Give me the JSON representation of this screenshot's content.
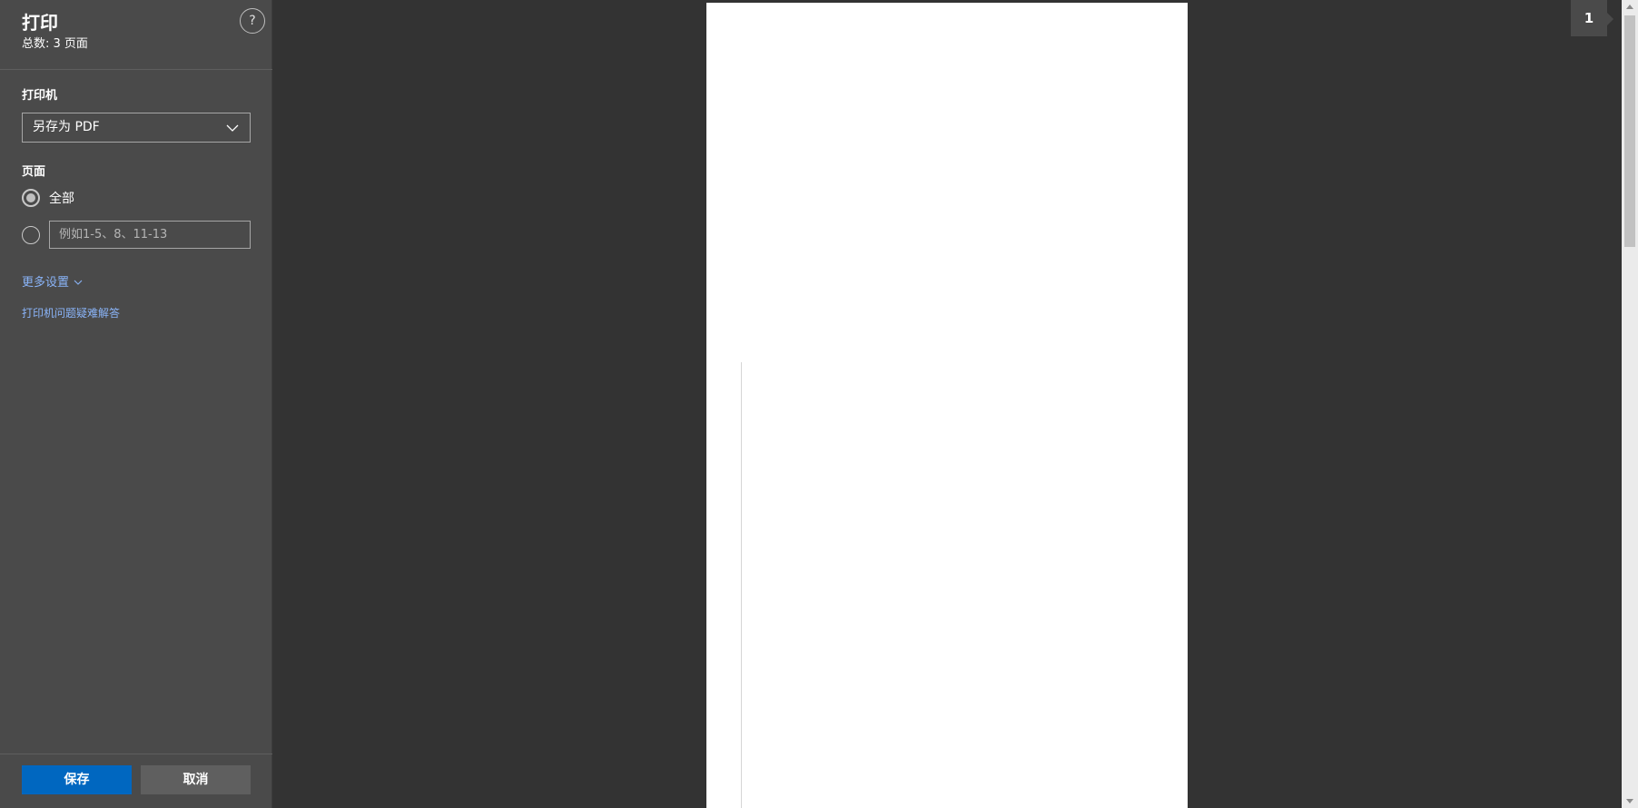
{
  "dialog": {
    "title": "打印",
    "subtitle": "总数: 3 页面",
    "help_label": "?"
  },
  "printer": {
    "label": "打印机",
    "selected": "另存为 PDF"
  },
  "pages": {
    "label": "页面",
    "all_label": "全部",
    "all_checked": true,
    "range_placeholder": "例如1-5、8、11-13",
    "range_value": ""
  },
  "links": {
    "more_settings": "更多设置",
    "troubleshoot": "打印机问题疑难解答"
  },
  "buttons": {
    "save": "保存",
    "cancel": "取消"
  },
  "preview": {
    "page_number": "1"
  },
  "colors": {
    "accent": "#0067c0",
    "link": "#8ab4f8",
    "sidebar_bg": "#4a4a4a",
    "preview_bg": "#333333"
  }
}
